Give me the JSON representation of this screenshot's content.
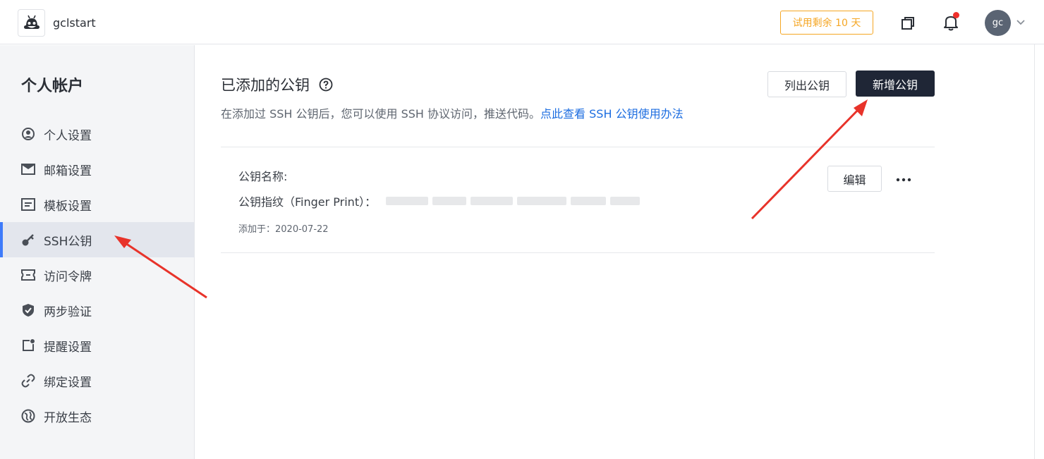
{
  "header": {
    "brand_name": "gclstart",
    "trial_label": "试用剩余 10 天",
    "avatar_initials": "gc",
    "icons": [
      "logo-icon",
      "window-copy-icon",
      "bell-icon",
      "chevron-down-icon"
    ],
    "notification_dot_color": "#f0302b"
  },
  "sidebar": {
    "title": "个人帐户",
    "active_index": 3,
    "items": [
      {
        "label": "个人设置",
        "icon": "user-circle-icon"
      },
      {
        "label": "邮箱设置",
        "icon": "mail-icon"
      },
      {
        "label": "模板设置",
        "icon": "template-icon"
      },
      {
        "label": "SSH公钥",
        "icon": "key-icon"
      },
      {
        "label": "访问令牌",
        "icon": "ticket-icon"
      },
      {
        "label": "两步验证",
        "icon": "shield-check-icon"
      },
      {
        "label": "提醒设置",
        "icon": "reminder-icon"
      },
      {
        "label": "绑定设置",
        "icon": "link-icon"
      },
      {
        "label": "开放生态",
        "icon": "globe-icon"
      }
    ]
  },
  "main": {
    "title": "已添加的公钥",
    "help_icon": "question-circle-icon",
    "description": "在添加过 SSH 公钥后，您可以使用 SSH 协议访问，推送代码。",
    "description_link": "点此查看 SSH 公钥使用办法",
    "list_button": "列出公钥",
    "add_button": "新增公钥",
    "key": {
      "name_label": "公钥名称:",
      "fingerprint_label": "公钥指纹（Finger Print）：",
      "added_label": "添加于：2020-07-22",
      "edit_button": "编辑",
      "more_icon": "more-horizontal-icon"
    }
  },
  "colors": {
    "accent": "#3e7bfa",
    "primary_button": "#1f2636",
    "trial": "#f5a623",
    "link": "#1c6de0",
    "annotation_arrow": "#e8332a"
  }
}
